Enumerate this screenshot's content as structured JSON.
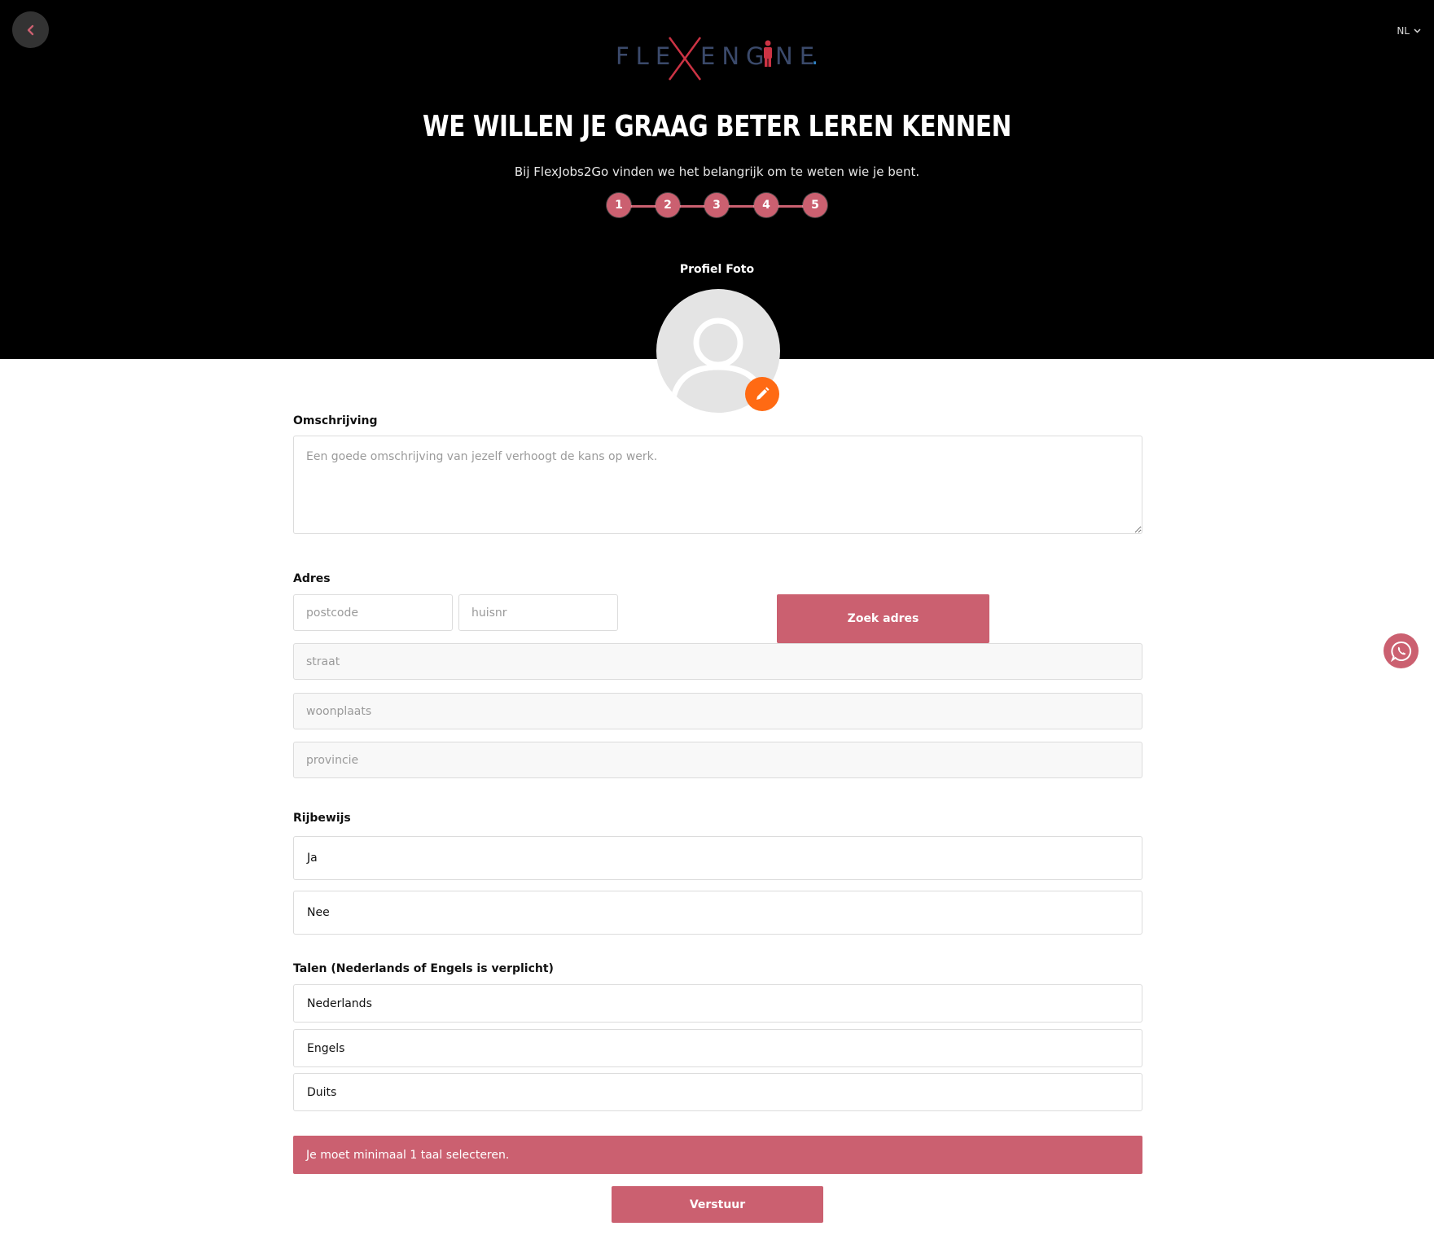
{
  "header": {
    "back_icon": "chevron-left-icon",
    "language": "NL",
    "logo": {
      "left_text": "FLE",
      "right_text": "ENG",
      "tail_text": "NE",
      "dot": ".",
      "accent_color": "#cc3344",
      "text_color": "#3b4a6b"
    },
    "title": "WE WILLEN JE GRAAG BETER LEREN KENNEN",
    "subtitle": "Bij FlexJobs2Go vinden we het belangrijk om te weten wie je bent.",
    "steps": [
      "1",
      "2",
      "3",
      "4",
      "5"
    ]
  },
  "profile_photo": {
    "label": "Profiel Foto",
    "edit_icon": "pencil-icon"
  },
  "form": {
    "description": {
      "label": "Omschrijving",
      "placeholder": "Een goede omschrijving van jezelf verhoogt de kans op werk.",
      "value": ""
    },
    "address": {
      "label": "Adres",
      "postcode_placeholder": "postcode",
      "huisnr_placeholder": "huisnr",
      "search_button": "Zoek adres",
      "straat_placeholder": "straat",
      "woonplaats_placeholder": "woonplaats",
      "provincie_placeholder": "provincie"
    },
    "license": {
      "label": "Rijbewijs",
      "options": [
        "Ja",
        "Nee"
      ]
    },
    "languages": {
      "label": "Talen (Nederlands of Engels is verplicht)",
      "options": [
        "Nederlands",
        "Engels",
        "Duits"
      ]
    },
    "error": "Je moet minimaal 1 taal selecteren.",
    "submit": "Verstuur"
  },
  "colors": {
    "primary": "#cb6070",
    "edit_button": "#ff6a13",
    "hero_background": "#000000"
  },
  "floating": {
    "whatsapp_icon": "whatsapp-icon"
  }
}
